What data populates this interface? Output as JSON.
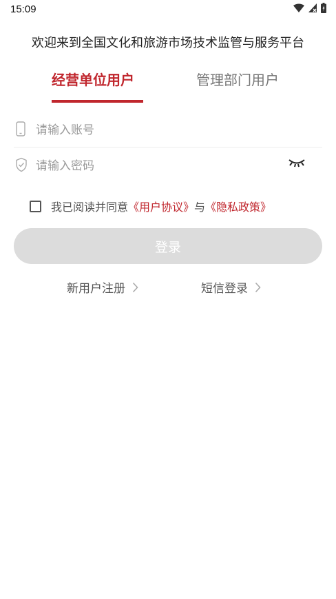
{
  "status_bar": {
    "time": "15:09",
    "icons": [
      "wifi-icon",
      "signal-icon",
      "battery-icon"
    ]
  },
  "header": {
    "title": "欢迎来到全国文化和旅游市场技术监管与服务平台"
  },
  "tabs": [
    {
      "label": "经营单位用户",
      "active": true
    },
    {
      "label": "管理部门用户",
      "active": false
    }
  ],
  "form": {
    "account": {
      "placeholder": "请输入账号",
      "value": "",
      "icon": "phone-icon"
    },
    "password": {
      "placeholder": "请输入密码",
      "value": "",
      "icon": "shield-icon",
      "toggle_icon": "eye-closed-icon"
    }
  },
  "agreement": {
    "checked": false,
    "prefix": "我已阅读并同意",
    "user_agreement": "《用户协议》",
    "connector": "与",
    "privacy_policy": "《隐私政策》"
  },
  "login_button": {
    "label": "登录"
  },
  "links": {
    "register": "新用户注册",
    "sms_login": "短信登录"
  },
  "colors": {
    "accent": "#c0262d",
    "button_disabled": "#dcdcdc"
  }
}
